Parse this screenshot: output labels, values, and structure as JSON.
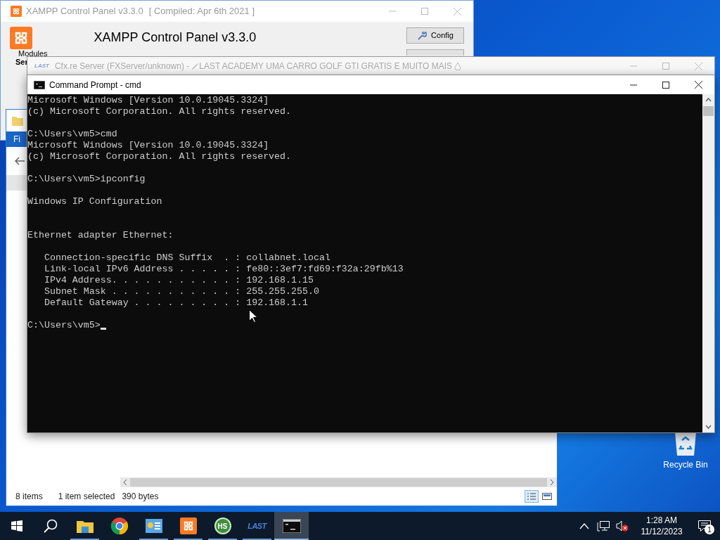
{
  "xampp": {
    "title": "XAMPP Control Panel v3.3.0",
    "compiled": "[ Compiled: Apr 6th 2021 ]",
    "heading": "XAMPP Control Panel v3.3.0",
    "config_button": "Config",
    "modules_label": "Modules",
    "column_1": "Ser"
  },
  "explorer": {
    "tab": "Fi",
    "status": [
      "8 items",
      "1 item selected",
      "390 bytes"
    ]
  },
  "fxserver": {
    "logo": "LAST",
    "title": "Cfx.re Server (FXServer/unknown) - ",
    "title_rest": "LAST ACADEMY UMA CARRO GOLF GTI GRATIS E MUITO MAIS"
  },
  "cmd": {
    "title": "Command Prompt - cmd",
    "lines": [
      {
        "kind": "text",
        "text": "Microsoft Windows [Version 10.0.19045.3324]"
      },
      {
        "kind": "text",
        "text": "(c) Microsoft Corporation. All rights reserved."
      },
      {
        "kind": "blank"
      },
      {
        "kind": "text",
        "text": "C:\\Users\\vm5>cmd"
      },
      {
        "kind": "text",
        "text": "Microsoft Windows [Version 10.0.19045.3324]"
      },
      {
        "kind": "text",
        "text": "(c) Microsoft Corporation. All rights reserved."
      },
      {
        "kind": "blank"
      },
      {
        "kind": "text",
        "text": "C:\\Users\\vm5>ipconfig"
      },
      {
        "kind": "blank"
      },
      {
        "kind": "text",
        "text": "Windows IP Configuration"
      },
      {
        "kind": "blank"
      },
      {
        "kind": "blank"
      },
      {
        "kind": "text",
        "text": "Ethernet adapter Ethernet:"
      },
      {
        "kind": "blank"
      },
      {
        "kind": "text",
        "text": "   Connection-specific DNS Suffix  . : collabnet.local"
      },
      {
        "kind": "text",
        "text": "   Link-local IPv6 Address . . . . . : fe80::3ef7:fd69:f32a:29fb%13"
      },
      {
        "kind": "text",
        "text": "   IPv4 Address. . . . . . . . . . . : 192.168.1.15"
      },
      {
        "kind": "text",
        "text": "   Subnet Mask . . . . . . . . . . . : 255.255.255.0"
      },
      {
        "kind": "text",
        "text": "   Default Gateway . . . . . . . . . : 192.168.1.1"
      },
      {
        "kind": "blank"
      },
      {
        "kind": "prompt",
        "text": "C:\\Users\\vm5>"
      }
    ]
  },
  "desktop": {
    "recycle_bin": "Recycle Bin"
  },
  "taskbar": {
    "items": [
      {
        "kind": "explorer",
        "running": true,
        "selected": false
      },
      {
        "kind": "chrome",
        "running": false,
        "selected": false
      },
      {
        "kind": "dashboard",
        "running": true,
        "selected": false
      },
      {
        "kind": "xampp",
        "running": true,
        "selected": false
      },
      {
        "kind": "badge",
        "label": "HS",
        "running": true,
        "selected": false
      },
      {
        "kind": "wordmark",
        "label": "LAST",
        "running": true,
        "selected": false
      },
      {
        "kind": "console",
        "running": true,
        "selected": true
      }
    ],
    "time": "1:28 AM",
    "date": "11/12/2023",
    "notifications": "1"
  }
}
